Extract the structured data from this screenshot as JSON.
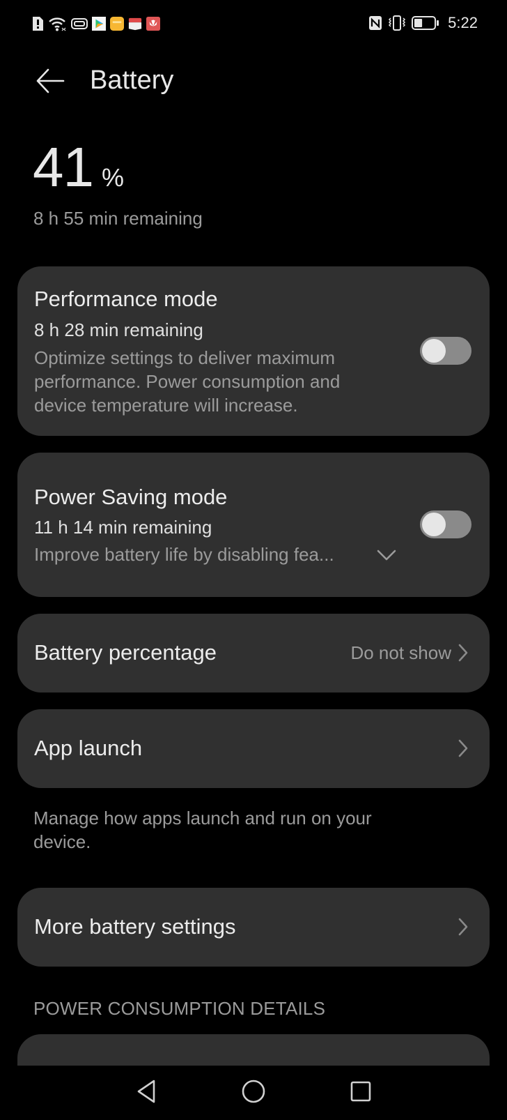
{
  "status_bar": {
    "left_icons": [
      "alert-sim-icon",
      "wifi-icon",
      "cast-icon",
      "video-app-icon",
      "files-app-icon",
      "gift-app-icon",
      "huawei-app-icon"
    ],
    "right_icons": [
      "nfc-icon",
      "vibrate-icon",
      "battery-icon"
    ],
    "battery_level": 0.41,
    "time": "5:22"
  },
  "header": {
    "back_icon": "arrow-left-icon",
    "title": "Battery"
  },
  "battery": {
    "percent": "41",
    "percent_sign": "%",
    "remaining": "8 h 55 min remaining"
  },
  "performance_mode": {
    "title": "Performance mode",
    "remaining": "8 h 28 min remaining",
    "description": "Optimize settings to deliver maximum performance. Power consumption and device temperature will increase.",
    "enabled": false
  },
  "power_saving_mode": {
    "title": "Power Saving mode",
    "remaining": "11 h 14 min remaining",
    "description": "Improve battery life by disabling fea...",
    "expand_icon": "chevron-down-icon",
    "enabled": false
  },
  "battery_percentage": {
    "title": "Battery percentage",
    "value": "Do not show"
  },
  "app_launch": {
    "title": "App launch",
    "note": "Manage how apps launch and run on your device."
  },
  "more_settings": {
    "title": "More battery settings"
  },
  "power_consumption": {
    "section_title": "POWER CONSUMPTION DETAILS"
  },
  "nav_bar": {
    "back": "back-triangle-icon",
    "home": "home-circle-icon",
    "recents": "recents-square-icon"
  },
  "colors": {
    "background": "#000000",
    "card": "#303030",
    "primary_text": "#e8e8e8",
    "secondary_text": "#9b9b9b",
    "toggle_track_off": "#8a8a8a",
    "toggle_knob": "#e6e6e6"
  }
}
